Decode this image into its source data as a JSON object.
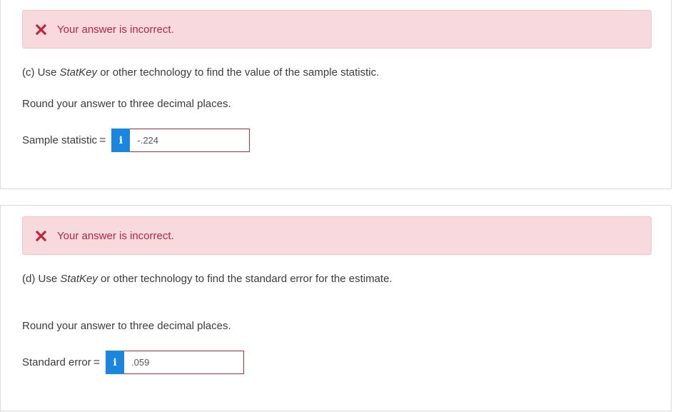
{
  "colors": {
    "error_bg": "#f8d9dd",
    "error_text": "#b0293a",
    "error_icon": "#c0273a",
    "info_button": "#1c86de",
    "input_border_error": "#c3283b"
  },
  "part_c": {
    "feedback": {
      "icon": "close-icon",
      "message": "Your answer is incorrect."
    },
    "question_prefix": "(c) Use ",
    "question_tool": "StatKey",
    "question_suffix": " or other technology to find the value of the sample statistic.",
    "instruction": "Round your answer to three decimal places.",
    "field": {
      "label": "Sample statistic",
      "equals": "=",
      "info_icon": "info-icon",
      "info_label": "i",
      "value": "-.224"
    }
  },
  "part_d": {
    "feedback": {
      "icon": "close-icon",
      "message": "Your answer is incorrect."
    },
    "question_prefix": "(d) Use ",
    "question_tool": "StatKey",
    "question_suffix": " or other technology to find the standard error for the estimate.",
    "instruction": "Round your answer to three decimal places.",
    "field": {
      "label": "Standard error",
      "equals": "=",
      "info_icon": "info-icon",
      "info_label": "i",
      "value": ".059"
    }
  }
}
